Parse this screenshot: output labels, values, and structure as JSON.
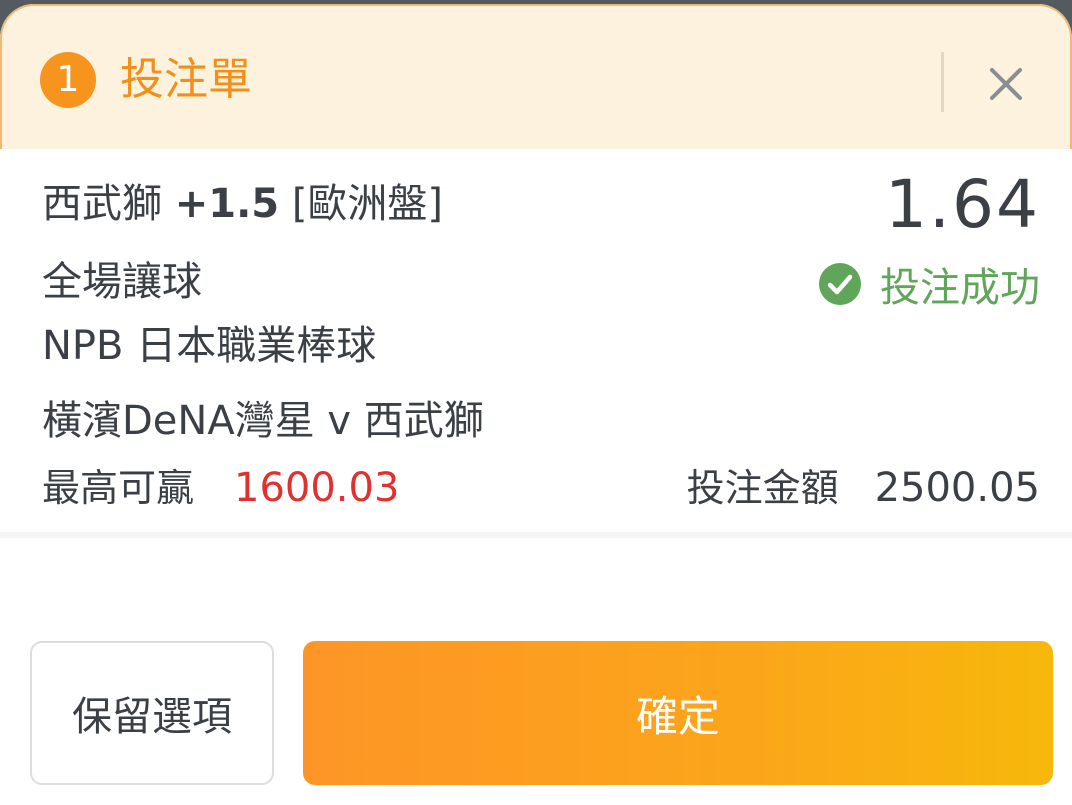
{
  "header": {
    "count": "1",
    "title": "投注單",
    "close_icon": "close-icon"
  },
  "bet": {
    "team": "西武獅",
    "handicap": "+1.5",
    "market_type": "[歐洲盤]",
    "odds": "1.64",
    "market": "全場讓球",
    "league": "NPB 日本職業棒球",
    "match": "橫濱DeNA灣星 v 西武獅",
    "status": "投注成功",
    "status_icon": "check-circle-icon",
    "max_win_label": "最高可贏",
    "max_win_value": "1600.03",
    "stake_label": "投注金額",
    "stake_value": "2500.05"
  },
  "actions": {
    "keep_label": "保留選項",
    "confirm_label": "確定"
  },
  "colors": {
    "accent": "#f7941d",
    "header_bg": "#fdf2de",
    "success": "#5fa55a",
    "max_win": "#e0312f",
    "text": "#3b3f46"
  }
}
